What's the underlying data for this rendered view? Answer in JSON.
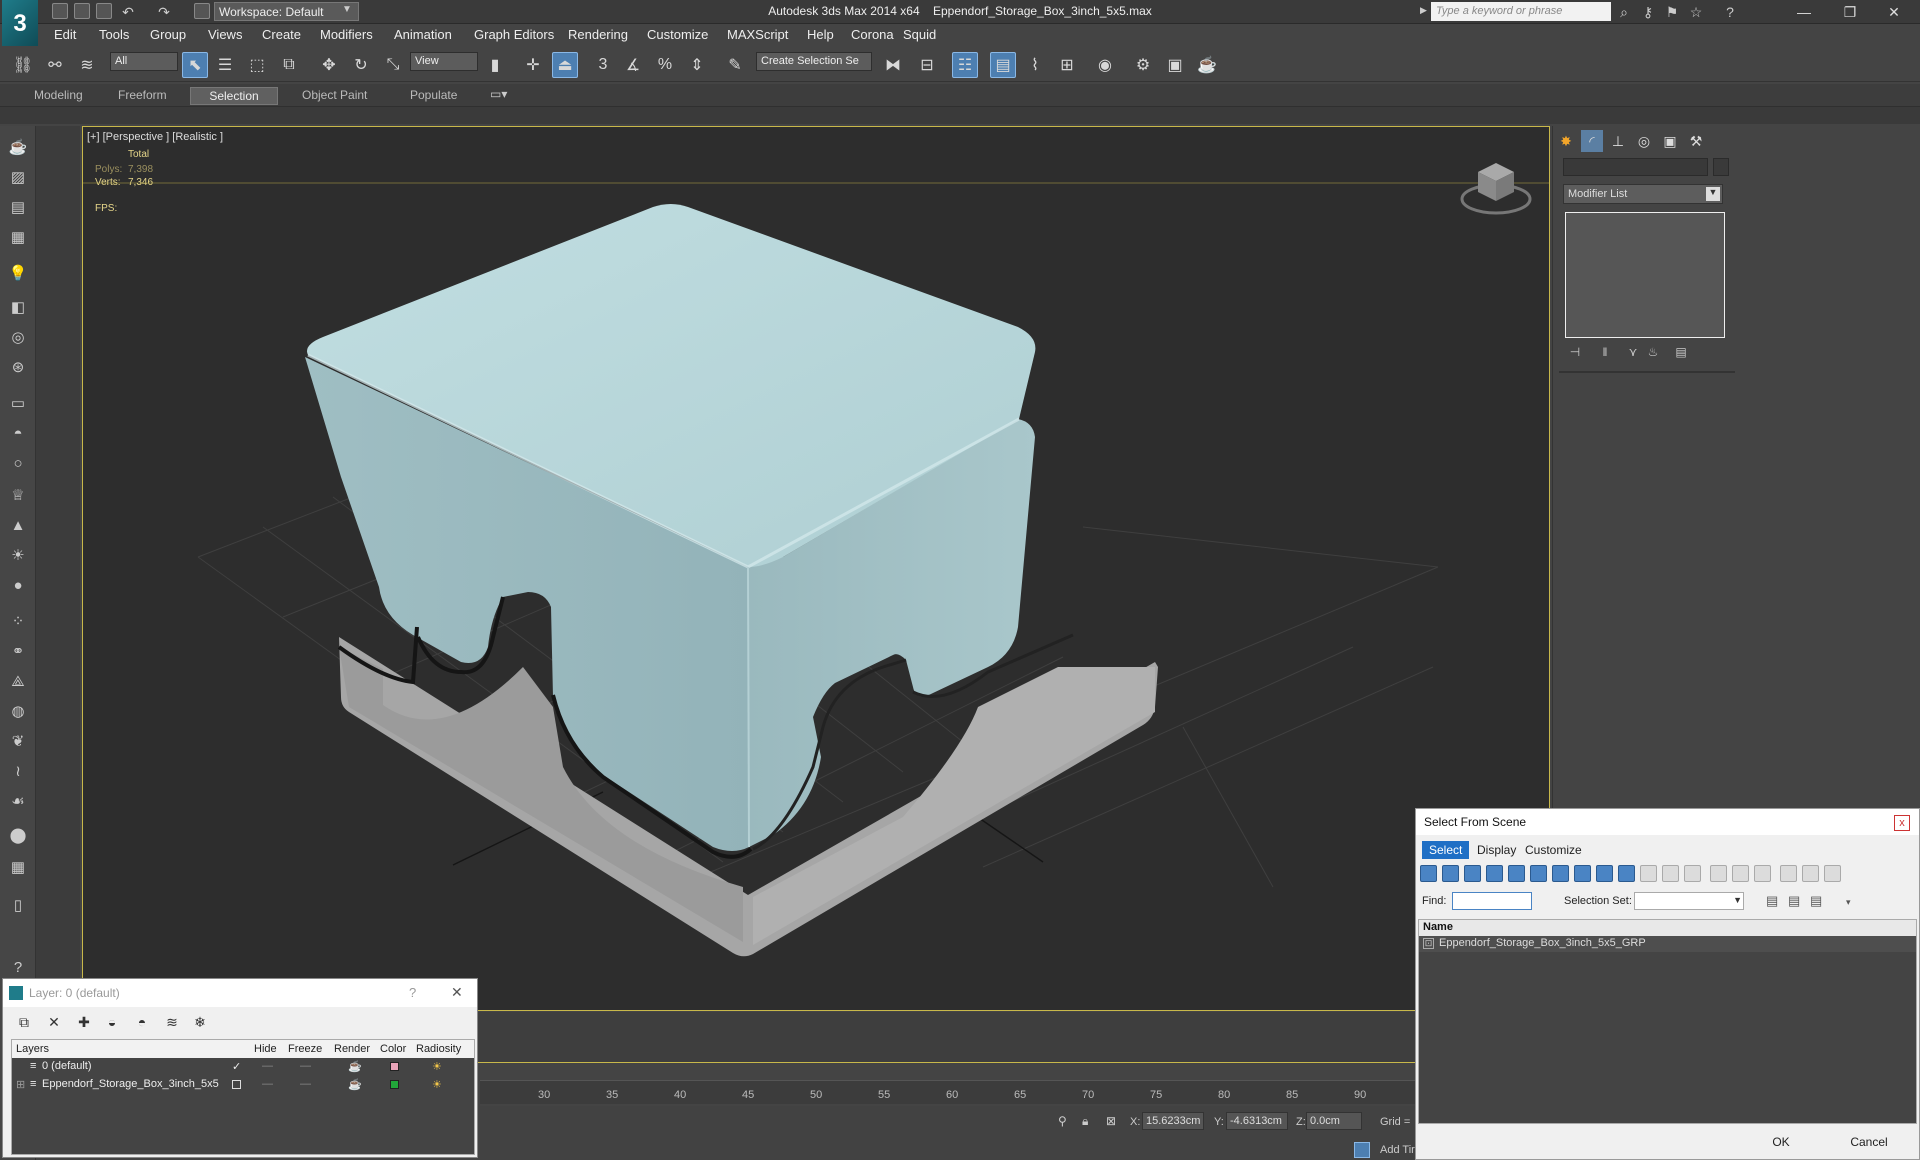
{
  "titlebar": {
    "app_title": "Autodesk 3ds Max  2014 x64",
    "file_name": "Eppendorf_Storage_Box_3inch_5x5.max",
    "workspace": "Workspace: Default",
    "search_placeholder": "Type a keyword or phrase"
  },
  "menu": [
    "Edit",
    "Tools",
    "Group",
    "Views",
    "Create",
    "Modifiers",
    "Animation",
    "Graph Editors",
    "Rendering",
    "Customize",
    "MAXScript",
    "Help",
    "Corona",
    "Squid"
  ],
  "toolbar": {
    "filter": "All",
    "ref_coord": "View",
    "selection_set": "Create Selection Se",
    "snap_3": "3",
    "angle_snap": "%"
  },
  "ribbon_tabs": [
    "Modeling",
    "Freeform",
    "Selection",
    "Object Paint",
    "Populate"
  ],
  "ribbon_active": "Selection",
  "viewport": {
    "label": "[+] [Perspective ] [Realistic ]",
    "total_label": "Total",
    "polys_label": "Polys:",
    "polys_value": "7,398",
    "verts_label": "Verts:",
    "verts_value": "7,346",
    "fps_label": "FPS:"
  },
  "command_panel": {
    "modifier_list": "Modifier List"
  },
  "timeline": {
    "ticks": [
      "30",
      "35",
      "40",
      "45",
      "50",
      "55",
      "60",
      "65",
      "70",
      "75",
      "80",
      "85",
      "90"
    ]
  },
  "status": {
    "x_label": "X:",
    "x_value": "15.6233cm",
    "y_label": "Y:",
    "y_value": "-4.6313cm",
    "z_label": "Z:",
    "z_value": "0.0cm",
    "grid_label": "Grid =",
    "add_time": "Add Tir"
  },
  "layer_dialog": {
    "title": "Layer: 0 (default)",
    "help": "?",
    "close": "✕",
    "columns": [
      "Layers",
      "Hide",
      "Freeze",
      "Render",
      "Color",
      "Radiosity"
    ],
    "rows": [
      {
        "name": "0 (default)",
        "color": "#e8a3b8",
        "active_mark": "✓"
      },
      {
        "name": "Eppendorf_Storage_Box_3inch_5x5",
        "color": "#22a63a",
        "active_mark": ""
      }
    ],
    "hide_mark": "—",
    "freeze_mark": "—"
  },
  "select_dialog": {
    "title": "Select From Scene",
    "close": "x",
    "tabs": [
      "Select",
      "Display",
      "Customize"
    ],
    "find_label": "Find:",
    "selset_label": "Selection Set:",
    "list_header": "Name",
    "items": [
      "Eppendorf_Storage_Box_3inch_5x5_GRP"
    ],
    "ok": "OK",
    "cancel": "Cancel"
  },
  "colors": {
    "box_top": "#b9d7da",
    "box_side_light": "#a8c7cb",
    "box_side_dark": "#8fb1b7",
    "base": "#a8a8a8",
    "viewport_bg": "#2d2d2d",
    "accent_blue": "#1f6fc5",
    "viewport_border": "#c8b84a"
  }
}
